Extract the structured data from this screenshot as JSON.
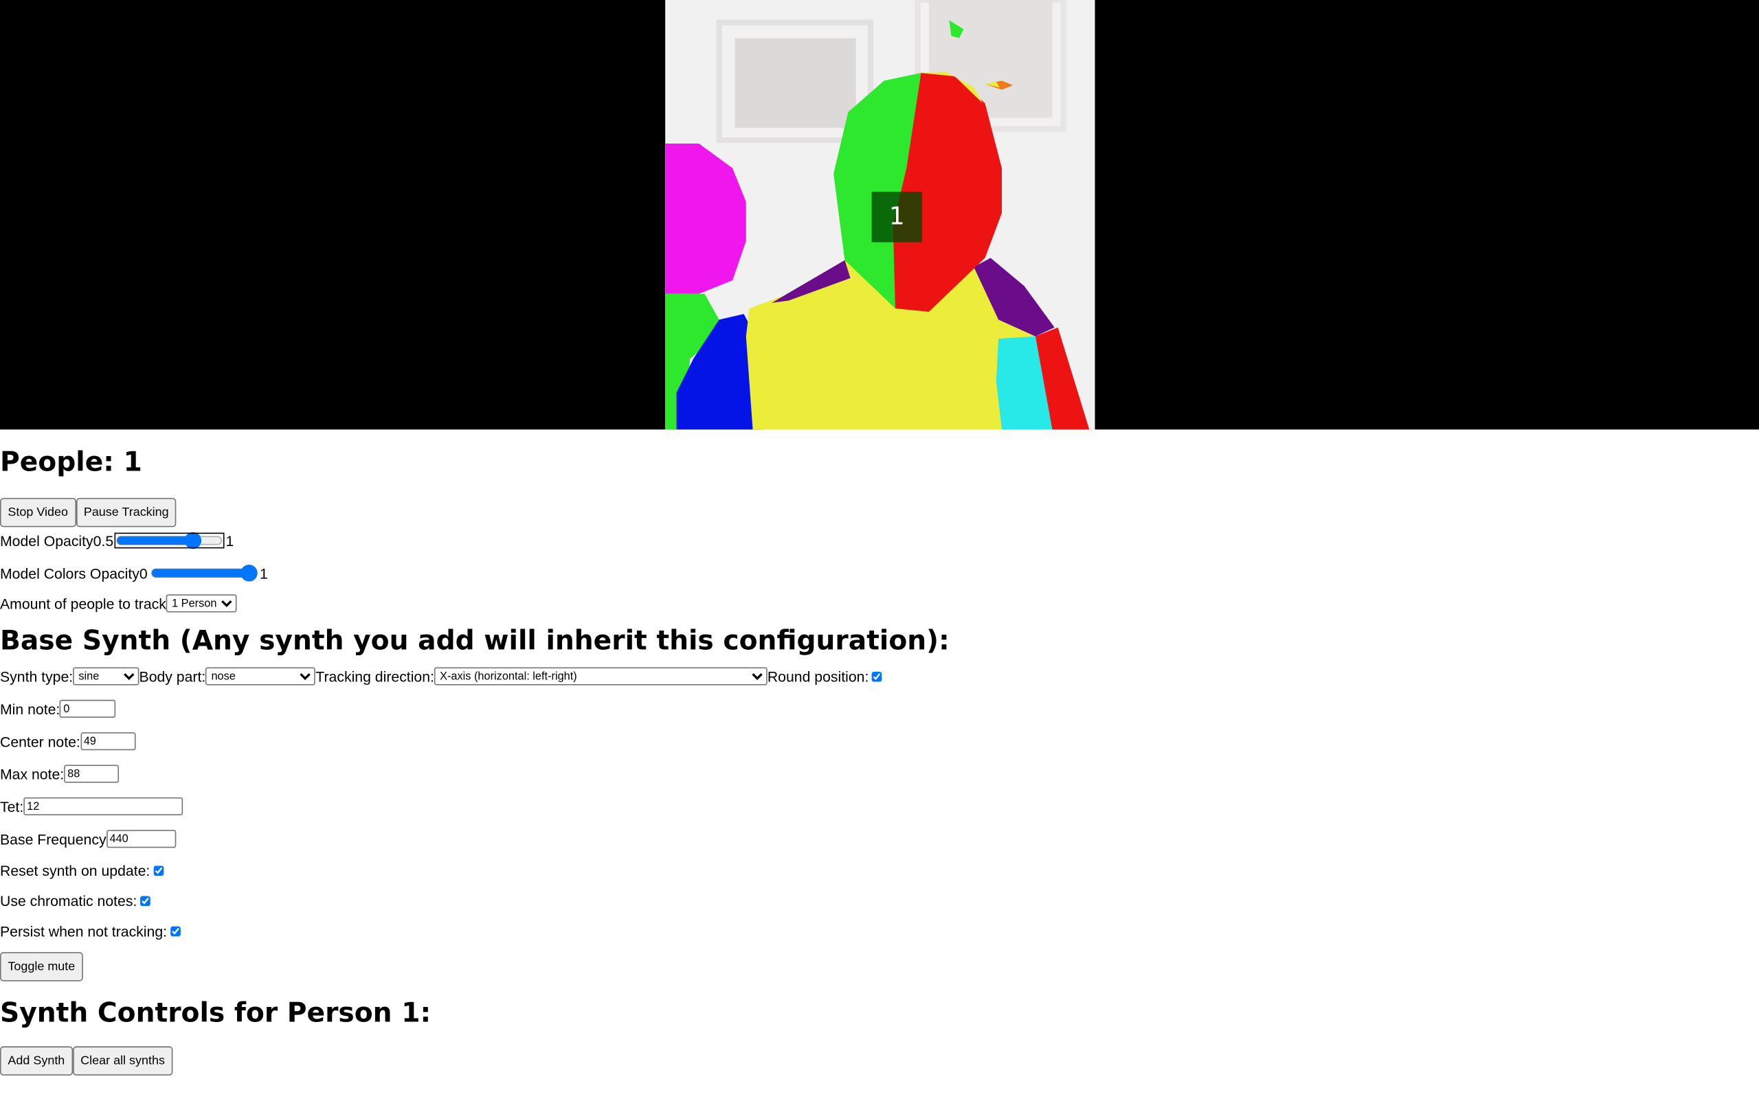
{
  "video": {
    "person_badge": "1"
  },
  "people": {
    "heading": "People: 1"
  },
  "controls": {
    "stop_video": "Stop Video",
    "pause_tracking": "Pause Tracking",
    "model_opacity": {
      "label": "Model Opacity",
      "min": "0.5",
      "max": "1",
      "value": 0.88
    },
    "model_colors_opacity": {
      "label": "Model Colors Opacity",
      "min": "0",
      "max": "1",
      "value": 1
    },
    "people_to_track": {
      "label": "Amount of people to track",
      "selected": "1 Person"
    }
  },
  "base_synth": {
    "heading": "Base Synth (Any synth you add will inherit this configuration):",
    "synth_type": {
      "label": "Synth type:",
      "selected": "sine"
    },
    "body_part": {
      "label": "Body part:",
      "selected": "nose"
    },
    "tracking_direction": {
      "label": "Tracking direction:",
      "selected": "X-axis (horizontal: left-right)"
    },
    "round_position": {
      "label": "Round position:",
      "checked": true
    },
    "min_note": {
      "label": "Min note:",
      "value": "0"
    },
    "center_note": {
      "label": "Center note:",
      "value": "49"
    },
    "max_note": {
      "label": "Max note:",
      "value": "88"
    },
    "tet": {
      "label": "Tet:",
      "value": "12"
    },
    "base_frequency": {
      "label": "Base Frequency",
      "value": "440"
    },
    "reset_synth": {
      "label": "Reset synth on update:",
      "checked": true
    },
    "chromatic_notes": {
      "label": "Use chromatic notes:",
      "checked": true
    },
    "persist": {
      "label": "Persist when not tracking:",
      "checked": true
    },
    "toggle_mute": "Toggle mute"
  },
  "person_synths": {
    "heading": "Synth Controls for Person 1:",
    "add_synth": "Add Synth",
    "clear_all": "Clear all synths"
  },
  "colors": {
    "accent": "#0075ff",
    "video_bg": "#000000"
  }
}
